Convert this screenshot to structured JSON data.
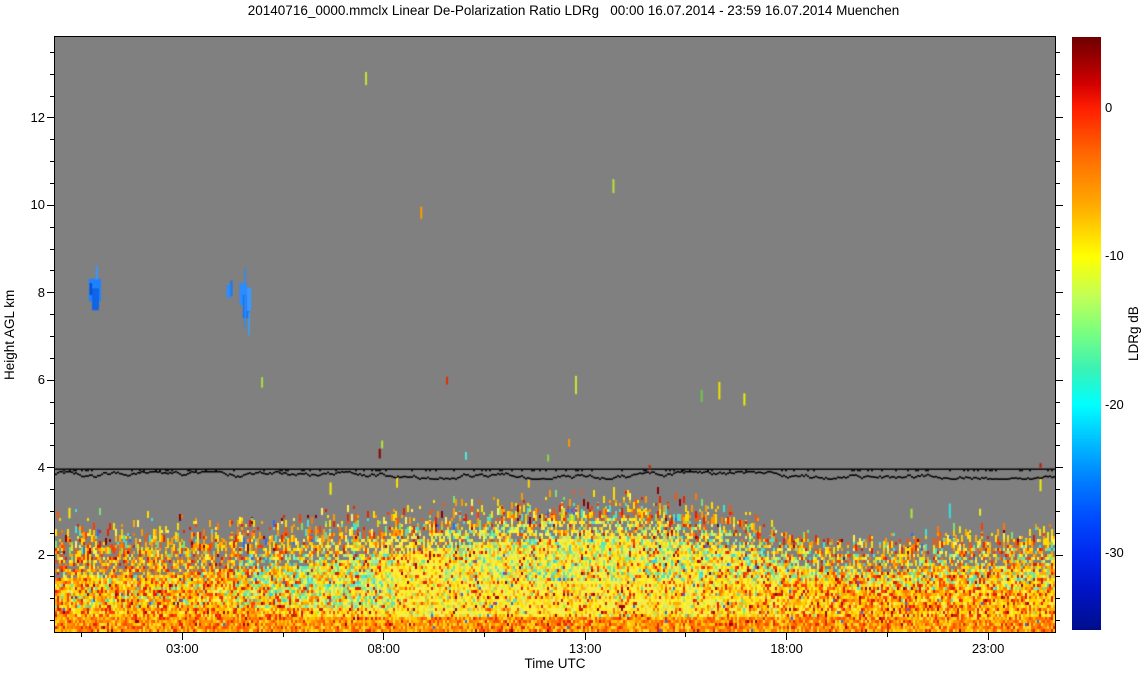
{
  "chart_data": {
    "type": "heatmap",
    "title": "20140716_0000.mmclx Linear De-Polarization Ratio LDRg   00:00 16.07.2014 - 23:59 16.07.2014 Muenchen",
    "xlabel": "Time UTC",
    "ylabel": "Height AGL km",
    "x_range_hours": [
      -0.16,
      24.66
    ],
    "y_range_km": [
      0.24,
      13.85
    ],
    "x_major_ticks": [
      {
        "hour": 3,
        "label": "03:00"
      },
      {
        "hour": 8,
        "label": "08:00"
      },
      {
        "hour": 13,
        "label": "13:00"
      },
      {
        "hour": 18,
        "label": "18:00"
      },
      {
        "hour": 23,
        "label": "23:00"
      }
    ],
    "x_minor_tick_hours": [
      0.5,
      5.5,
      10.5,
      15.5,
      20.5
    ],
    "y_major_ticks_km": [
      2,
      4,
      6,
      8,
      10,
      12
    ],
    "y_minor_tick_step_km": 0.5,
    "no_data_color": "#808080",
    "background_color": "#ffffff",
    "seed": 20140716,
    "colorbar": {
      "label": "LDRg dB",
      "colormap": "jet",
      "vmax_db": 4.8,
      "vmin_db": -35.2,
      "tick_labels": [
        {
          "value": 0,
          "label": "0"
        },
        {
          "value": -10,
          "label": "-10"
        },
        {
          "value": -20,
          "label": "-20"
        },
        {
          "value": -30,
          "label": "-30"
        }
      ],
      "gradient_stops": [
        [
          "#6f0000",
          0
        ],
        [
          "#9e0000",
          4
        ],
        [
          "#d40000",
          8
        ],
        [
          "#ff1e00",
          12
        ],
        [
          "#ff6a00",
          20
        ],
        [
          "#ffa700",
          28
        ],
        [
          "#ffff00",
          37
        ],
        [
          "#c4ff54",
          43.5
        ],
        [
          "#7dff7d",
          49.5
        ],
        [
          "#3af2b4",
          56
        ],
        [
          "#00ffff",
          62
        ],
        [
          "#00c0ff",
          68
        ],
        [
          "#0080ff",
          74.5
        ],
        [
          "#004cff",
          81
        ],
        [
          "#002af0",
          87
        ],
        [
          "#0014c8",
          93
        ],
        [
          "#000e8c",
          100
        ]
      ]
    },
    "features": {
      "noise_line": {
        "height_km": 3.98,
        "color": "#000000",
        "jitter_below_km": 0.18
      },
      "cloud_blobs": [
        [
          0.68,
          0.98,
          8.32,
          7.8,
          "#1e82ff"
        ],
        [
          0.76,
          0.93,
          8.1,
          7.6,
          "#0f64e8"
        ],
        [
          0.85,
          0.9,
          8.62,
          8.3,
          "#3b96ff"
        ],
        [
          0.7,
          0.76,
          8.22,
          7.95,
          "#0a4ed0"
        ],
        [
          4.1,
          4.19,
          8.18,
          7.88,
          "#2a8cff"
        ],
        [
          4.19,
          4.25,
          8.28,
          7.92,
          "#1e7af0"
        ],
        [
          4.42,
          4.6,
          8.22,
          7.72,
          "#2a8cff"
        ],
        [
          4.5,
          4.66,
          7.95,
          7.42,
          "#1e74e8"
        ],
        [
          4.6,
          4.71,
          8.12,
          7.58,
          "#3b96ff"
        ],
        [
          4.545,
          4.585,
          8.55,
          7.2,
          "#2a8cff"
        ],
        [
          4.64,
          4.68,
          7.55,
          7.02,
          "#35a0ff"
        ]
      ],
      "isolated_specks": [
        [
          7.56,
          13.05,
          0.3,
          "#cce233"
        ],
        [
          8.93,
          9.97,
          0.28,
          "#ff9900"
        ],
        [
          13.7,
          10.6,
          0.32,
          "#b8e23a"
        ],
        [
          4.98,
          6.07,
          0.24,
          "#a8e23a"
        ],
        [
          9.57,
          6.08,
          0.18,
          "#e03000"
        ],
        [
          12.77,
          6.1,
          0.42,
          "#c8e838"
        ],
        [
          15.89,
          5.78,
          0.28,
          "#66cc44"
        ],
        [
          16.33,
          5.96,
          0.4,
          "#f0e000"
        ],
        [
          16.95,
          5.7,
          0.28,
          "#eeee00"
        ],
        [
          7.96,
          4.62,
          0.18,
          "#b8e23a"
        ],
        [
          7.9,
          4.43,
          0.22,
          "#8b0000"
        ],
        [
          10.04,
          4.36,
          0.18,
          "#55e8d8"
        ],
        [
          12.6,
          4.66,
          0.18,
          "#ff9900"
        ],
        [
          12.08,
          4.3,
          0.16,
          "#88dd44"
        ],
        [
          6.68,
          3.66,
          0.28,
          "#ffee00"
        ],
        [
          8.33,
          3.76,
          0.22,
          "#ffe000"
        ],
        [
          11.6,
          3.72,
          0.18,
          "#ffd000"
        ],
        [
          14.6,
          4.06,
          0.1,
          "#cc2200"
        ],
        [
          21.1,
          3.06,
          0.22,
          "#aaee33"
        ],
        [
          22.05,
          3.18,
          0.34,
          "#33e0e0"
        ],
        [
          22.8,
          3.06,
          0.16,
          "#eeee22"
        ],
        [
          22.3,
          2.66,
          0.16,
          "#eeee00"
        ],
        [
          24.3,
          3.74,
          0.28,
          "#eeee00"
        ],
        [
          24.3,
          4.1,
          0.1,
          "#cc1100"
        ],
        [
          0.2,
          3.08,
          0.24,
          "#ffee00"
        ]
      ],
      "boundary_layer": {
        "solid_top_profile": [
          [
            0,
            1.9
          ],
          [
            2,
            1.95
          ],
          [
            4,
            2.0
          ],
          [
            5,
            2.1
          ],
          [
            6,
            2.15
          ],
          [
            7,
            2.3
          ],
          [
            8,
            2.4
          ],
          [
            9,
            2.5
          ],
          [
            10,
            2.6
          ],
          [
            11,
            2.7
          ],
          [
            12,
            2.75
          ],
          [
            13,
            2.8
          ],
          [
            14,
            2.85
          ],
          [
            15,
            2.75
          ],
          [
            16,
            2.6
          ],
          [
            17,
            2.45
          ],
          [
            18,
            2.2
          ],
          [
            19,
            2.05
          ],
          [
            20,
            2.0
          ],
          [
            21,
            2.05
          ],
          [
            22,
            2.1
          ],
          [
            23,
            2.15
          ],
          [
            24.7,
            2.2
          ]
        ],
        "speckle_top_profile": [
          [
            0,
            3.1
          ],
          [
            1,
            3.0
          ],
          [
            2,
            2.95
          ],
          [
            4,
            2.95
          ],
          [
            6,
            3.0
          ],
          [
            8,
            3.15
          ],
          [
            10,
            3.3
          ],
          [
            12,
            3.4
          ],
          [
            13,
            3.45
          ],
          [
            14,
            3.5
          ],
          [
            15,
            3.45
          ],
          [
            16,
            3.25
          ],
          [
            17,
            3.0
          ],
          [
            18,
            2.65
          ],
          [
            19,
            2.5
          ],
          [
            20,
            2.45
          ],
          [
            21,
            2.55
          ],
          [
            22,
            2.6
          ],
          [
            23,
            2.65
          ],
          [
            24.7,
            2.7
          ]
        ],
        "warmth_profile": [
          [
            0,
            0.95
          ],
          [
            5,
            0.9
          ],
          [
            6,
            0.72
          ],
          [
            7,
            0.5
          ],
          [
            8,
            0.33
          ],
          [
            10,
            0.26
          ],
          [
            13,
            0.28
          ],
          [
            15,
            0.33
          ],
          [
            16,
            0.42
          ],
          [
            17,
            0.55
          ],
          [
            18,
            0.7
          ],
          [
            19,
            0.85
          ],
          [
            21,
            0.88
          ],
          [
            24.7,
            0.85
          ]
        ],
        "bottom_band_km": 0.55,
        "palette_warm": [
          [
            "#ffdd00",
            0.2
          ],
          [
            "#ffaa00",
            0.2
          ],
          [
            "#ff7700",
            0.16
          ],
          [
            "#ff3c00",
            0.12
          ],
          [
            "#e81800",
            0.07
          ],
          [
            "#ffee44",
            0.12
          ],
          [
            "#cc2200",
            0.05
          ],
          [
            "#ffc800",
            0.08
          ]
        ],
        "palette_day": [
          [
            "#fdf032",
            0.3
          ],
          [
            "#f5ec55",
            0.16
          ],
          [
            "#ffe81e",
            0.14
          ],
          [
            "#e4ee5a",
            0.12
          ],
          [
            "#ffd020",
            0.08
          ],
          [
            "#ffaa22",
            0.07
          ],
          [
            "#c9ea60",
            0.06
          ],
          [
            "#8ce87e",
            0.035
          ],
          [
            "#4ce2c9",
            0.025
          ]
        ],
        "palette_bottom": [
          [
            "#ff9400",
            0.26
          ],
          [
            "#ff7000",
            0.2
          ],
          [
            "#ffc400",
            0.2
          ],
          [
            "#ff4a00",
            0.13
          ],
          [
            "#ffdd26",
            0.13
          ],
          [
            "#e82200",
            0.08
          ]
        ],
        "palette_speckle": [
          [
            "#ff9900",
            0.18
          ],
          [
            "#ff5500",
            0.14
          ],
          [
            "#ffdd00",
            0.2
          ],
          [
            "#e82500",
            0.09
          ],
          [
            "#8b0000",
            0.05
          ],
          [
            "#44e0d0",
            0.13
          ],
          [
            "#7fe070",
            0.08
          ],
          [
            "#2a6cff",
            0.04
          ],
          [
            "#ffee66",
            0.09
          ]
        ],
        "cyan_green_colors": [
          [
            "#4ce8cc",
            1
          ],
          [
            "#7fe690",
            0.9
          ],
          [
            "#b4f070",
            0.8
          ],
          [
            "#2fd8e0",
            0.5
          ],
          [
            "#96ecb4",
            0.6
          ]
        ],
        "green_patches": [
          [
            4.3,
            8.3,
            0.8,
            2.0,
            0.3
          ],
          [
            9.5,
            19.5,
            1.4,
            3.0,
            0.22
          ],
          [
            19.5,
            24.7,
            1.2,
            2.6,
            0.2
          ],
          [
            0,
            4.3,
            0.8,
            1.6,
            0.1
          ]
        ]
      }
    }
  }
}
